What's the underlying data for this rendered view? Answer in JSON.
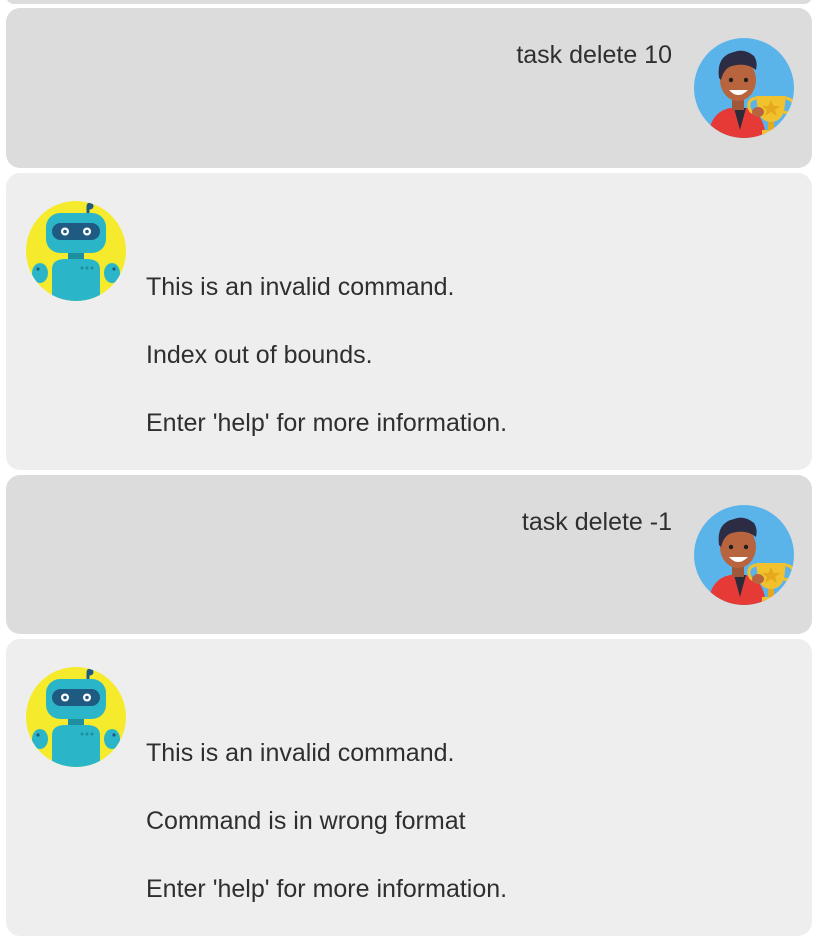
{
  "messages": [
    {
      "role": "user",
      "text": "task delete 10",
      "avatar": "user-trophy-avatar"
    },
    {
      "role": "bot",
      "avatar": "robot-avatar",
      "lines": [
        "This is an invalid command.",
        "Index out of bounds.",
        "Enter 'help' for more information."
      ]
    },
    {
      "role": "user",
      "text": "task delete -1",
      "avatar": "user-trophy-avatar"
    },
    {
      "role": "bot",
      "avatar": "robot-avatar",
      "lines": [
        "This is an invalid command.",
        "Command is in wrong format",
        "Enter 'help' for more information."
      ]
    }
  ],
  "colors": {
    "user_bubble": "#dcdcdc",
    "bot_bubble": "#eeeeee",
    "text": "#2f2f2f",
    "user_avatar_bg": "#5ab4ea",
    "bot_avatar_bg": "#f6ea2c",
    "robot_body": "#2ab6c8",
    "trophy": "#f2c12e",
    "shirt": "#e63a36"
  }
}
